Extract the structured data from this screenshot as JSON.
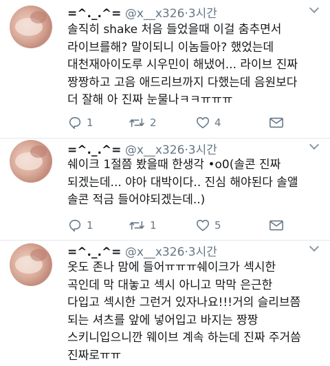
{
  "tweets": [
    {
      "display_name": "=^._.^=",
      "handle": "@x__x326",
      "separator": "·",
      "time": "3시간",
      "text": "솔직히 shake 처음 들었을때 이걸 춤추면서\n라이브를해? 말이되니 이놈들아? 했었는데\n대천재아이도루 시우민이 해냈어... 라이브 진짜\n짱짱하고 고음 애드리브까지 다했는데 음원보다\n더 잘해 아 진짜 눈물나ㅋㅋㅠㅠㅠ",
      "reply_count": "1",
      "retweet_count": "2",
      "like_count": "4"
    },
    {
      "display_name": "=^._.^=",
      "handle": "@x__x326",
      "separator": "·",
      "time": "3시간",
      "text": "쉐이크 1절쯤 봤을때 한생각 •o0(솔콘 진짜\n되겠는데... 야아 대박이다.. 진심 해야된다 솔앨\n솔콘 적금 들어야되겠는데..)",
      "reply_count": "1",
      "retweet_count": "1",
      "like_count": "5"
    },
    {
      "display_name": "=^._.^=",
      "handle": "@x__x326",
      "separator": "·",
      "time": "3시간",
      "text": "옷도 존나 맘에 들어ㅠㅠㅠ쉐이크가 섹시한\n곡인데 막 대놓고 섹시 아니고 막막 은근한\n다입고 섹시한 그런거 있자나요!!!거의 슬리브쯤\n되는 셔츠를 앞에 넣어입고 바지는 짱짱\n스키니입으니깐 웨이브 계속 하는데 진짜 주거씀\n진짜로ㅠㅠ"
    }
  ],
  "icons": {
    "reply": "reply-icon",
    "retweet": "retweet-icon",
    "like": "heart-icon",
    "dm": "envelope-icon",
    "more": "chevron-down-icon"
  },
  "colors": {
    "icon": "#657786",
    "divider": "#e1e8ed",
    "text": "#14171a"
  }
}
